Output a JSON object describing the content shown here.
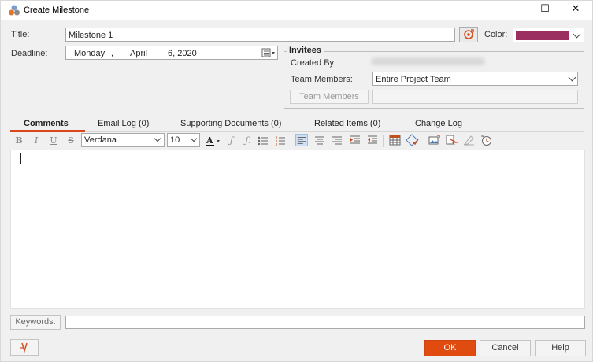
{
  "window": {
    "title": "Create Milestone",
    "minimize_glyph": "—",
    "maximize_glyph": "☐",
    "close_glyph": "✕"
  },
  "form": {
    "title_label": "Title:",
    "title_value": "Milestone 1",
    "color_label": "Color:",
    "color_value": "#9b2f62",
    "deadline_label": "Deadline:",
    "deadline": {
      "weekday": "Monday",
      "sep": ",",
      "month": "April",
      "day_year": "6, 2020"
    }
  },
  "invitees": {
    "legend": "Invitees",
    "created_by_label": "Created By:",
    "team_members_label": "Team Members:",
    "team_members_value": "Entire Project Team",
    "team_members_button": "Team Members"
  },
  "tabs": [
    {
      "label": "Comments"
    },
    {
      "label": "Email Log (0)"
    },
    {
      "label": "Supporting Documents (0)"
    },
    {
      "label": "Related Items (0)"
    },
    {
      "label": "Change Log"
    }
  ],
  "toolbar": {
    "bold": "B",
    "italic": "I",
    "underline": "U",
    "strike": "S",
    "font": "Verdana",
    "size": "10"
  },
  "keywords": {
    "label": "Keywords:",
    "value": ""
  },
  "buttons": {
    "ok": "OK",
    "cancel": "Cancel",
    "help": "Help"
  },
  "colors": {
    "accent": "#e04b0f",
    "tab_underline": "#d9481c"
  }
}
